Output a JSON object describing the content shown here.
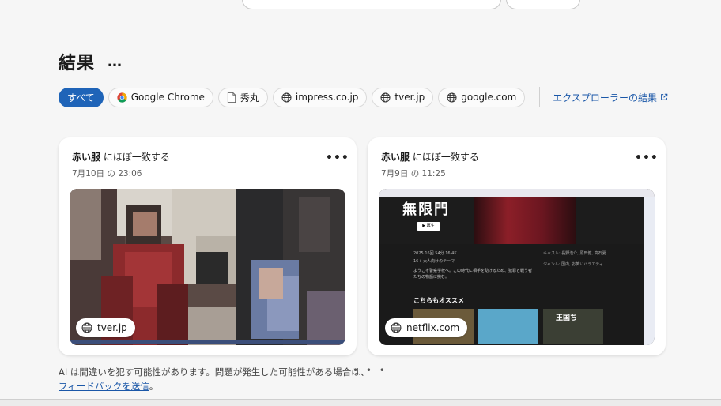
{
  "results": {
    "title": "結果",
    "more": "…"
  },
  "filters": [
    {
      "label": "すべて",
      "icon": "none",
      "active": true
    },
    {
      "label": "Google Chrome",
      "icon": "chrome-icon",
      "active": false
    },
    {
      "label": "秀丸",
      "icon": "document-icon",
      "active": false
    },
    {
      "label": "impress.co.jp",
      "icon": "globe-icon",
      "active": false
    },
    {
      "label": "tver.jp",
      "icon": "globe-icon",
      "active": false
    },
    {
      "label": "google.com",
      "icon": "globe-icon",
      "active": false
    }
  ],
  "explorer_link": {
    "label": "エクスプローラーの結果",
    "icon": "external-link-icon"
  },
  "cards": [
    {
      "title_bold": "赤い服",
      "title_rest": " にほぼ一致する",
      "date": "7月10日 の 23:06",
      "menu": "•••",
      "site": "tver.jp",
      "site_icon": "globe-icon"
    },
    {
      "title_bold": "赤い服",
      "title_rest": " にほぼ一致する",
      "date": "7月9日 の 11:25",
      "menu": "•••",
      "site": "netflix.com",
      "site_icon": "globe-icon",
      "screenshot": {
        "hero_title": "無限門",
        "play_label": "▶ 再生",
        "meta": "2025 16回 54分 16 4K",
        "tags": "16+ 大人向けのテーマ",
        "desc": "ようこそ警察学校へ。この時代に相手を助けるため、犯罪と戦う者たちの物語に挑む。",
        "cast_line1": "キャスト: 長野浩介, 原田健, 高石夏",
        "cast_line2": "ジャンル: 国内, お笑いバラエティ",
        "row_title": "こちらもオススメ",
        "row_item": "王国ち"
      }
    }
  ],
  "footer": {
    "disclaimer": "AI は間違いを犯す可能性があります。問題が発生した可能性がある場合は、",
    "link": "フィードバックを送信",
    "tail": "。",
    "dots": "• • •"
  },
  "colors": {
    "accent": "#1f64b8",
    "link": "#1a57a8"
  }
}
